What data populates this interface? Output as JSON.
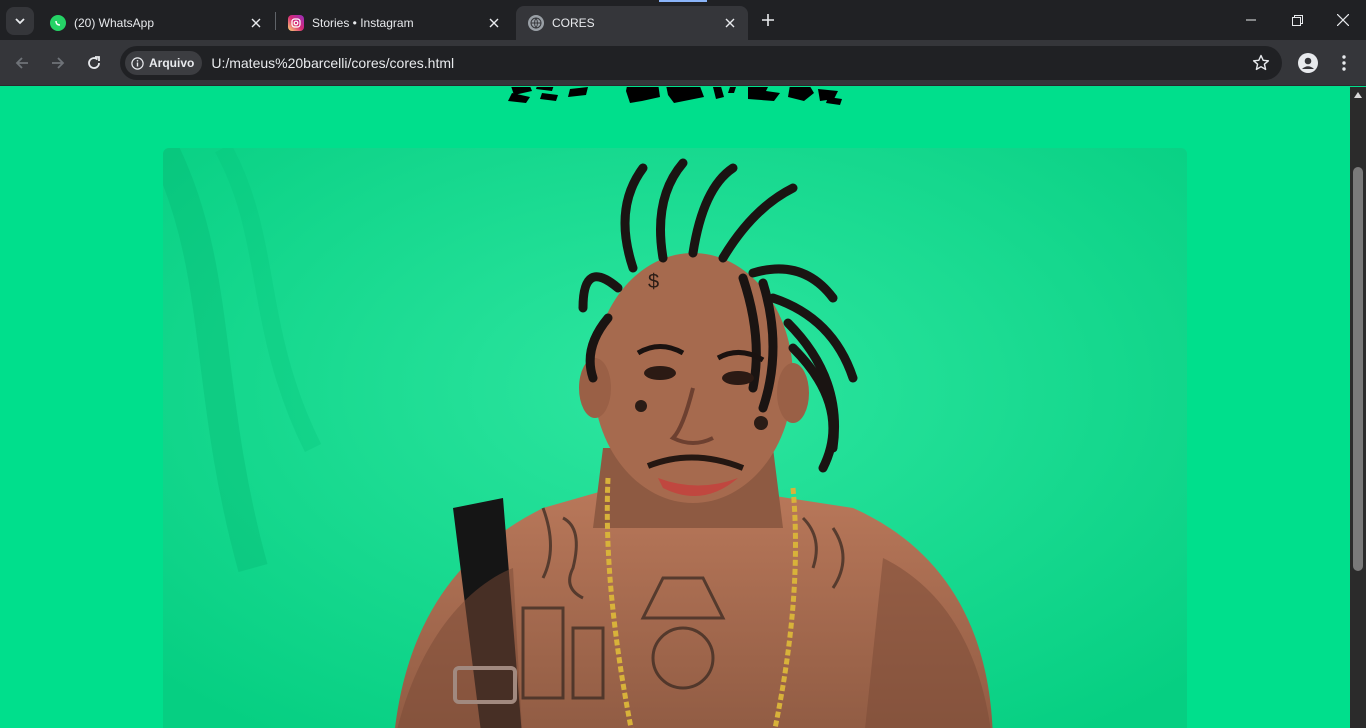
{
  "browser": {
    "tabs": [
      {
        "title": "(20) WhatsApp",
        "favicon": "whatsapp-icon",
        "active": false
      },
      {
        "title": "Stories • Instagram",
        "favicon": "instagram-icon",
        "active": false
      },
      {
        "title": "CORES",
        "favicon": "globe-icon",
        "active": true
      }
    ],
    "address_bar": {
      "security_chip": "Arquivo",
      "url": "U:/mateus%20barcelli/cores/cores.html"
    }
  },
  "page": {
    "background_color": "#00df8c",
    "heading_logo": "stylized black graffiti heading (partially scrolled out of view)",
    "main_image": "portrait photo of a tattooed man with dreadlocks and gold chain on green backdrop"
  },
  "colors": {
    "accent_green": "#00df8c",
    "chrome_dark": "#202124",
    "chrome_mid": "#35363a",
    "text_light": "#e8eaed"
  }
}
